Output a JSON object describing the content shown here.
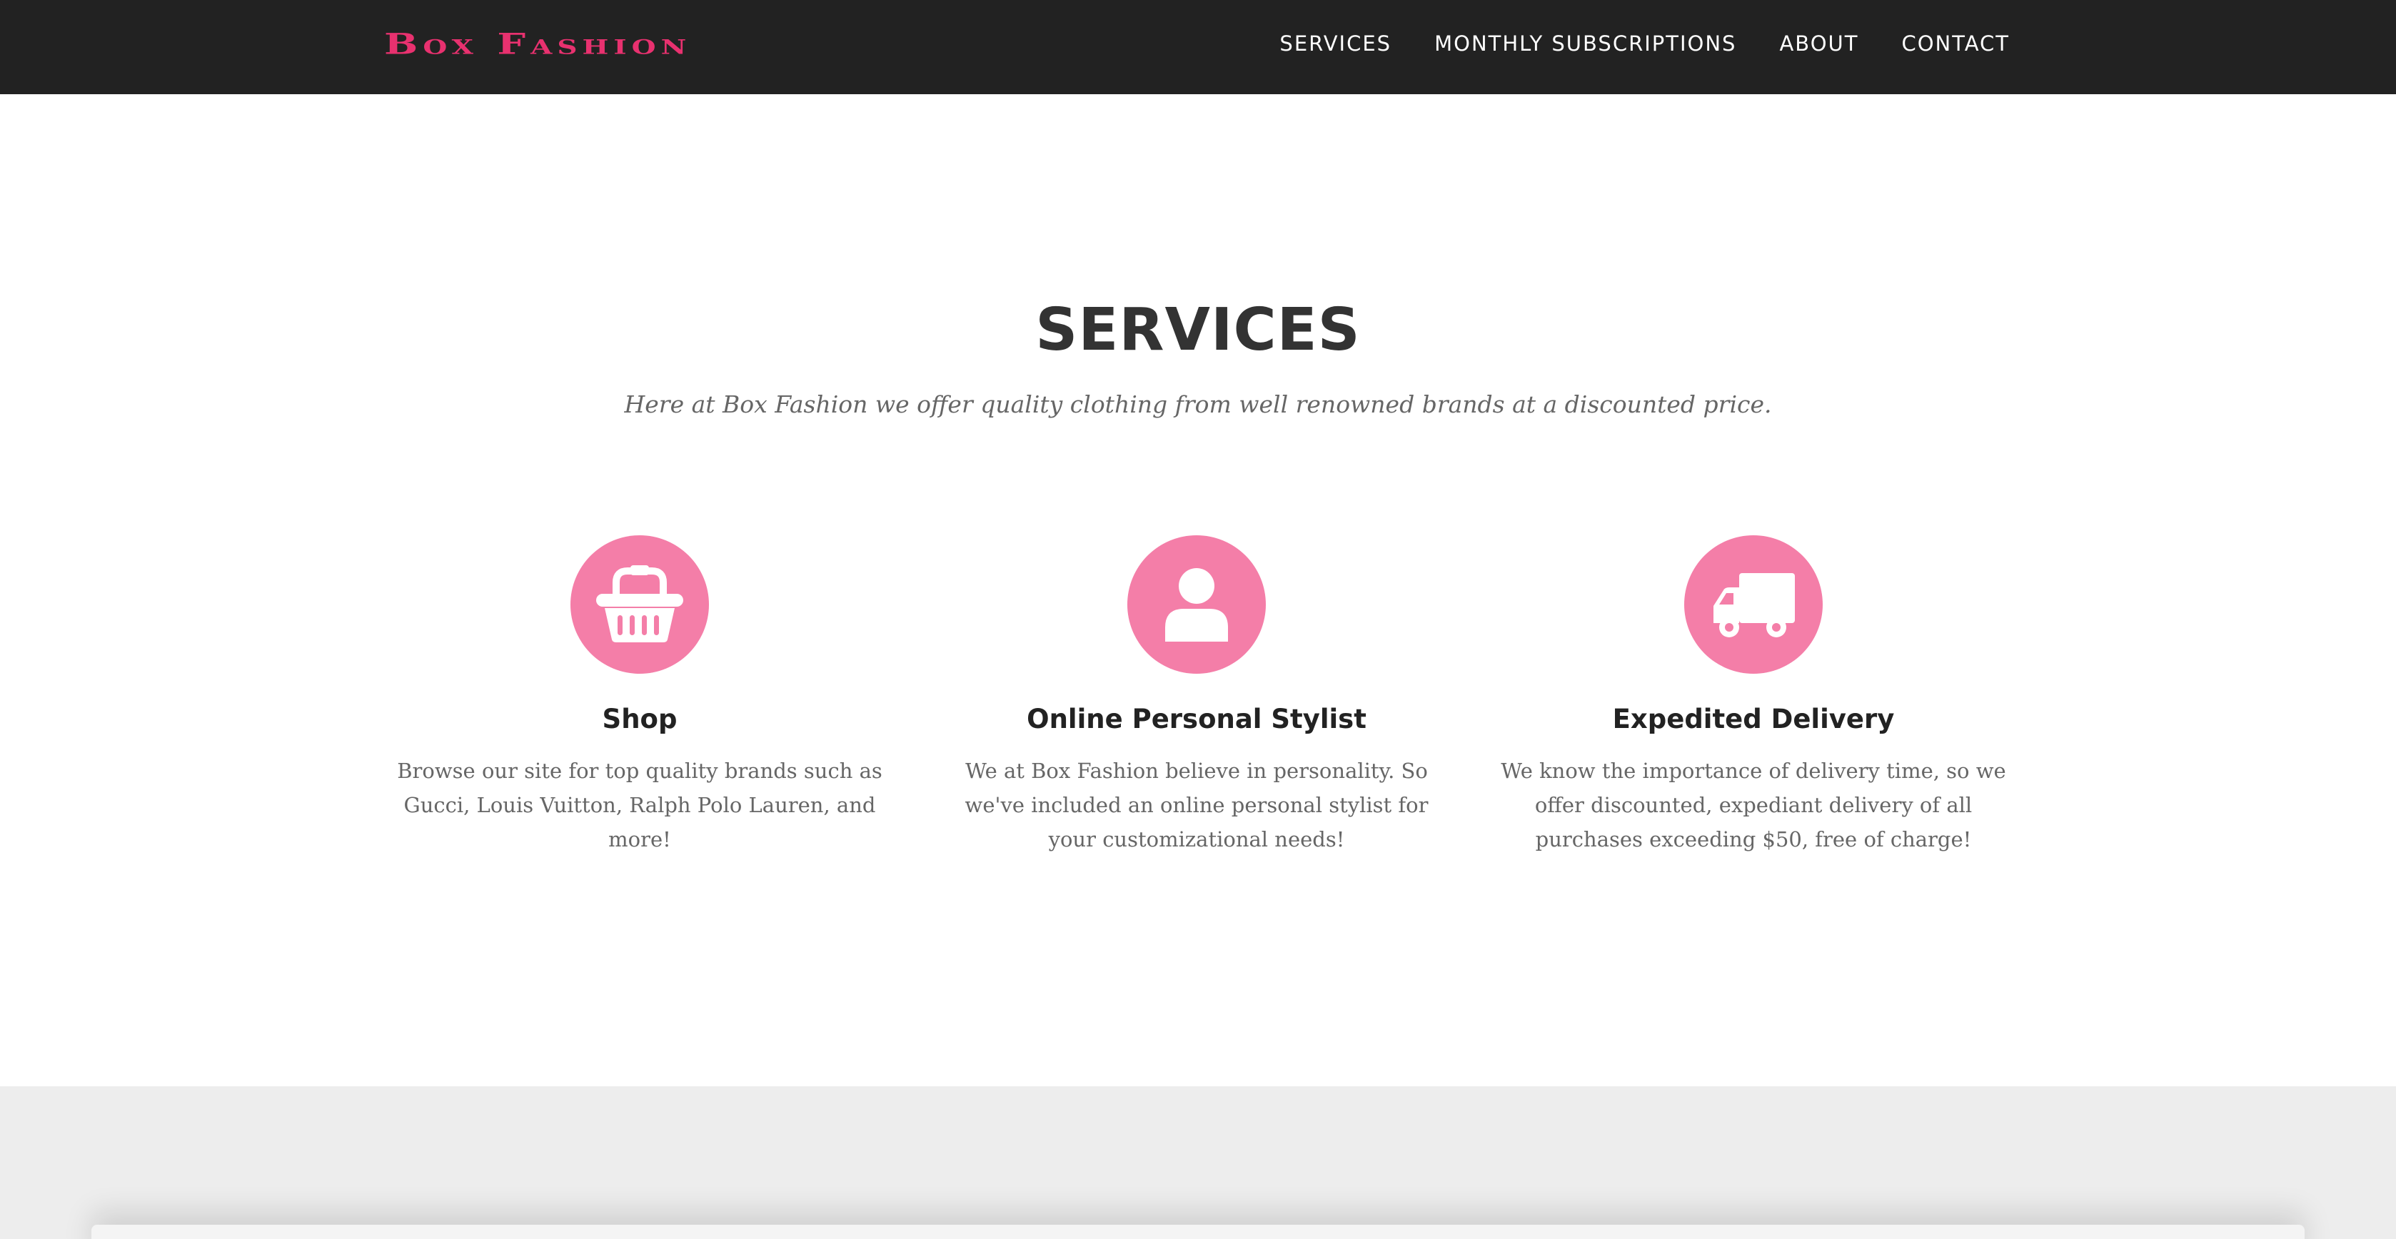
{
  "brand": {
    "name": "Box Fashion",
    "color": "#e8316f"
  },
  "nav": {
    "items": [
      {
        "label": "SERVICES"
      },
      {
        "label": "MONTHLY SUBSCRIPTIONS"
      },
      {
        "label": "ABOUT"
      },
      {
        "label": "CONTACT"
      }
    ]
  },
  "services": {
    "heading": "SERVICES",
    "subheading": "Here at Box Fashion we offer quality clothing from well renowned brands at a discounted price.",
    "accent_color": "#f47ea8",
    "items": [
      {
        "icon": "shopping-basket-icon",
        "title": "Shop",
        "text": "Browse our site for top quality brands such as Gucci, Louis Vuitton, Ralph Polo Lauren, and more!"
      },
      {
        "icon": "user-icon",
        "title": "Online Personal Stylist",
        "text": "We at Box Fashion believe in personality. So we've included an online personal stylist for your customizational needs!"
      },
      {
        "icon": "truck-icon",
        "title": "Expedited Delivery",
        "text": "We know the importance of delivery time, so we offer discounted, expediant delivery of all purchases exceeding $50, free of charge!"
      }
    ]
  },
  "colors": {
    "navbar_bg": "#222222",
    "next_section_bg": "#ededed"
  }
}
